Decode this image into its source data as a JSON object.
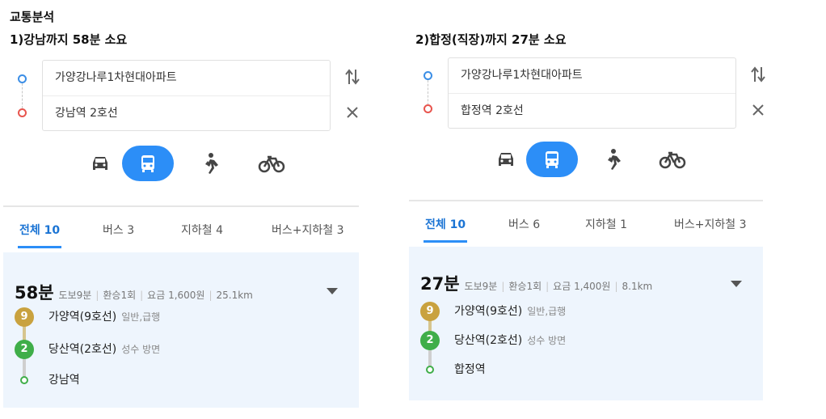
{
  "page": {
    "section_title": "교통분석"
  },
  "panels": [
    {
      "header": "1)강남까지 58분 소요",
      "origin": "가양강나루1차현대아파트",
      "destination": "강남역 2호선",
      "tabs": [
        {
          "label": "전체 10",
          "active": true
        },
        {
          "label": "버스 3"
        },
        {
          "label": "지하철 4"
        },
        {
          "label": "버스+지하철 3"
        }
      ],
      "route": {
        "time": "58분",
        "walk": "도보9분",
        "transfer": "환승1회",
        "fare": "요금 1,600원",
        "distance": "25.1km",
        "stops": [
          {
            "badge": "9",
            "name": "가양역(9호선)",
            "sub": "일반,급행"
          },
          {
            "badge": "2",
            "name": "당산역(2호선)",
            "sub": "성수 방면"
          },
          {
            "name": "강남역"
          }
        ]
      }
    },
    {
      "header": "2)합정(직장)까지 27분 소요",
      "origin": "가양강나루1차현대아파트",
      "destination": "합정역 2호선",
      "tabs": [
        {
          "label": "전체 10",
          "active": true
        },
        {
          "label": "버스 6"
        },
        {
          "label": "지하철 1"
        },
        {
          "label": "버스+지하철 3"
        }
      ],
      "route": {
        "time": "27분",
        "walk": "도보9분",
        "transfer": "환승1회",
        "fare": "요금 1,400원",
        "distance": "8.1km",
        "stops": [
          {
            "badge": "9",
            "name": "가양역(9호선)",
            "sub": "일반,급행"
          },
          {
            "badge": "2",
            "name": "당산역(2호선)",
            "sub": "성수 방면"
          },
          {
            "name": "합정역"
          }
        ]
      }
    }
  ],
  "icons": [
    "swap-icon",
    "close-icon",
    "car-icon",
    "bus-icon",
    "walk-icon",
    "bike-icon",
    "chevron-down-icon"
  ],
  "colors": {
    "accent": "#2c8ef7",
    "line9": "#c9a23f",
    "line2": "#3fae49",
    "origin": "#3b8ee6",
    "destination": "#e8554e"
  }
}
